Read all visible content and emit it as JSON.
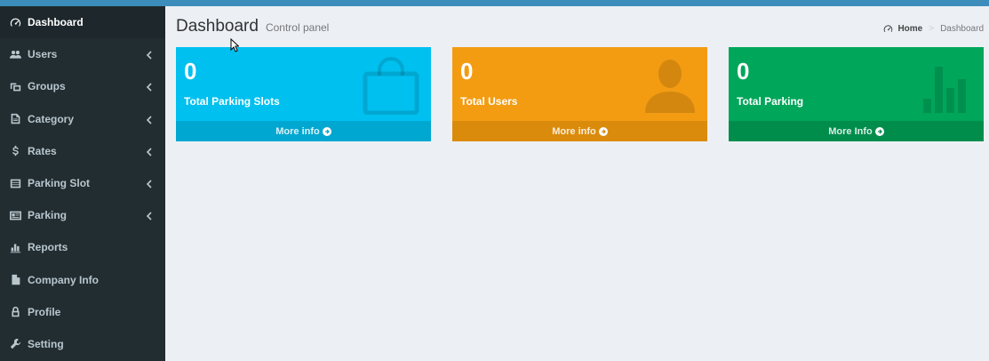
{
  "sidebar": {
    "items": [
      {
        "label": "Dashboard",
        "icon": "dashboard-icon",
        "active": true
      },
      {
        "label": "Users",
        "icon": "users-icon"
      },
      {
        "label": "Groups",
        "icon": "groups-icon"
      },
      {
        "label": "Category",
        "icon": "category-icon"
      },
      {
        "label": "Rates",
        "icon": "dollar-icon"
      },
      {
        "label": "Parking Slot",
        "icon": "list-icon"
      },
      {
        "label": "Parking",
        "icon": "id-card-icon"
      },
      {
        "label": "Reports",
        "icon": "bar-chart-icon"
      },
      {
        "label": "Company Info",
        "icon": "file-icon"
      },
      {
        "label": "Profile",
        "icon": "lock-icon"
      },
      {
        "label": "Setting",
        "icon": "wrench-icon"
      }
    ]
  },
  "header": {
    "title": "Dashboard",
    "subtitle": "Control panel"
  },
  "breadcrumb": {
    "home": "Home",
    "current": "Dashboard"
  },
  "boxes": [
    {
      "count": "0",
      "label": "Total Parking Slots",
      "more": "More info",
      "color": "#00c0ef",
      "icon": "shopping-bag-icon"
    },
    {
      "count": "0",
      "label": "Total Users",
      "more": "More info",
      "color": "#f39c12",
      "icon": "person-icon"
    },
    {
      "count": "0",
      "label": "Total Parking",
      "more": "More Info",
      "color": "#00a65a",
      "icon": "bar-chart-icon"
    }
  ],
  "colors": {
    "topbar": "#3c8dbc",
    "sidebar_bg": "#222d32",
    "content_bg": "#ecf0f5"
  }
}
